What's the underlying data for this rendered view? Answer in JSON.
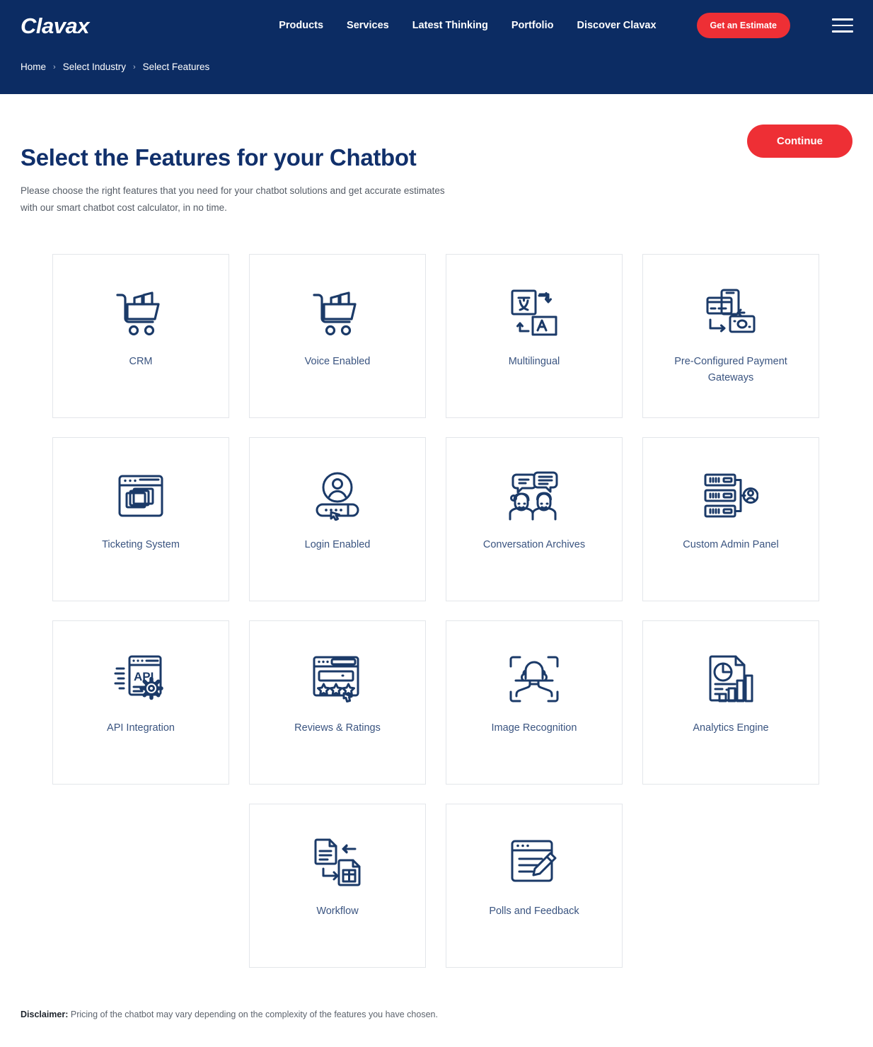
{
  "header": {
    "logo": "Clavax",
    "nav": [
      {
        "label": "Products"
      },
      {
        "label": "Services"
      },
      {
        "label": "Latest Thinking"
      },
      {
        "label": "Portfolio"
      },
      {
        "label": "Discover Clavax"
      }
    ],
    "estimate_button": "Get an Estimate",
    "menu_icon": "hamburger-menu-icon",
    "breadcrumb": [
      {
        "label": "Home"
      },
      {
        "label": "Select Industry"
      },
      {
        "label": "Select Features"
      }
    ],
    "breadcrumb_separator": "›",
    "background_color": "#0c2c63"
  },
  "main": {
    "title": "Select the Features for your Chatbot",
    "subtitle": "Please choose the right features that you need for your chatbot solutions and get accurate estimates with our smart chatbot cost calculator, in no time.",
    "continue_button": "Continue",
    "accent_color": "#ee2f35",
    "title_color": "#11306b",
    "icon_color": "#1b3a68",
    "features": [
      {
        "label": "CRM",
        "icon": "shopping-cart-icon"
      },
      {
        "label": "Voice Enabled",
        "icon": "shopping-cart-icon"
      },
      {
        "label": "Multilingual",
        "icon": "translate-icon"
      },
      {
        "label": "Pre-Configured Payment Gateways",
        "icon": "payment-gateway-icon"
      },
      {
        "label": "Ticketing System",
        "icon": "browser-windows-icon"
      },
      {
        "label": "Login Enabled",
        "icon": "user-password-icon"
      },
      {
        "label": "Conversation Archives",
        "icon": "people-chat-icon"
      },
      {
        "label": "Custom Admin Panel",
        "icon": "server-user-icon"
      },
      {
        "label": "API Integration",
        "icon": "api-gear-icon"
      },
      {
        "label": "Reviews & Ratings",
        "icon": "star-rating-icon"
      },
      {
        "label": "Image Recognition",
        "icon": "face-scan-icon"
      },
      {
        "label": "Analytics Engine",
        "icon": "chart-report-icon"
      },
      {
        "label": "Workflow",
        "icon": "document-exchange-icon"
      },
      {
        "label": "Polls and Feedback",
        "icon": "form-pencil-icon"
      }
    ]
  },
  "footer": {
    "disclaimer_label": "Disclaimer:",
    "disclaimer_text": " Pricing of the chatbot may vary depending on the complexity of the features you have chosen."
  }
}
